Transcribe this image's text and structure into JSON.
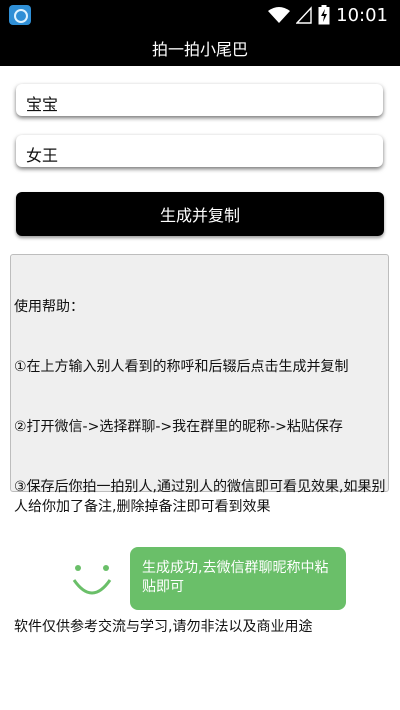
{
  "status_bar": {
    "time": "10:01",
    "icons": [
      "wifi-icon",
      "signal-icon",
      "battery-charging-icon"
    ]
  },
  "title_bar": {
    "title": "拍一拍小尾巴"
  },
  "inputs": {
    "first_value": "宝宝",
    "second_value": "女王"
  },
  "generate_button": {
    "label": "生成并复制"
  },
  "help": {
    "heading": "使用帮助：",
    "step1": "①在上方输入别人看到的称呼和后辍后点击生成并复制",
    "step2": "②打开微信->选择群聊->我在群里的昵称->粘贴保存",
    "step3": "③保存后你拍一拍别人,通过别人的微信即可看见效果,如果别人给你加了备注,删除掉备注即可看到效果",
    "disclaimer": "软件仅供参考交流与学习,请勿非法以及商业用途"
  },
  "toast": {
    "message": "生成成功,去微信群聊昵称中粘贴即可"
  },
  "colors": {
    "bar": "#000000",
    "toast": "#6abf69",
    "smiley": "#6abf69",
    "help_bg": "#efefef"
  }
}
